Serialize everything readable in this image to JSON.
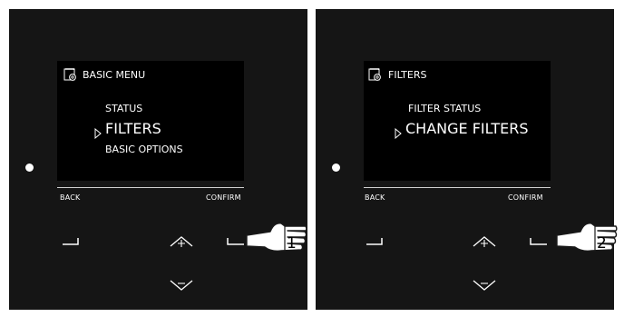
{
  "colors": {
    "panel": "#151515",
    "screen": "#000000",
    "text": "#ffffff",
    "line": "#cfcfcf"
  },
  "panels": [
    {
      "title": "BASIC MENU",
      "title_icon": "calendar-gear-icon",
      "items": [
        "STATUS",
        "FILTERS",
        "BASIC OPTIONS"
      ],
      "selected_index": 1,
      "back_label": "BACK",
      "confirm_label": "CONFIRM",
      "step": "1"
    },
    {
      "title": "FILTERS",
      "title_icon": "calendar-gear-icon",
      "items": [
        "FILTER STATUS",
        "CHANGE FILTERS"
      ],
      "selected_index": 1,
      "back_label": "BACK",
      "confirm_label": "CONFIRM",
      "step": "2"
    }
  ]
}
